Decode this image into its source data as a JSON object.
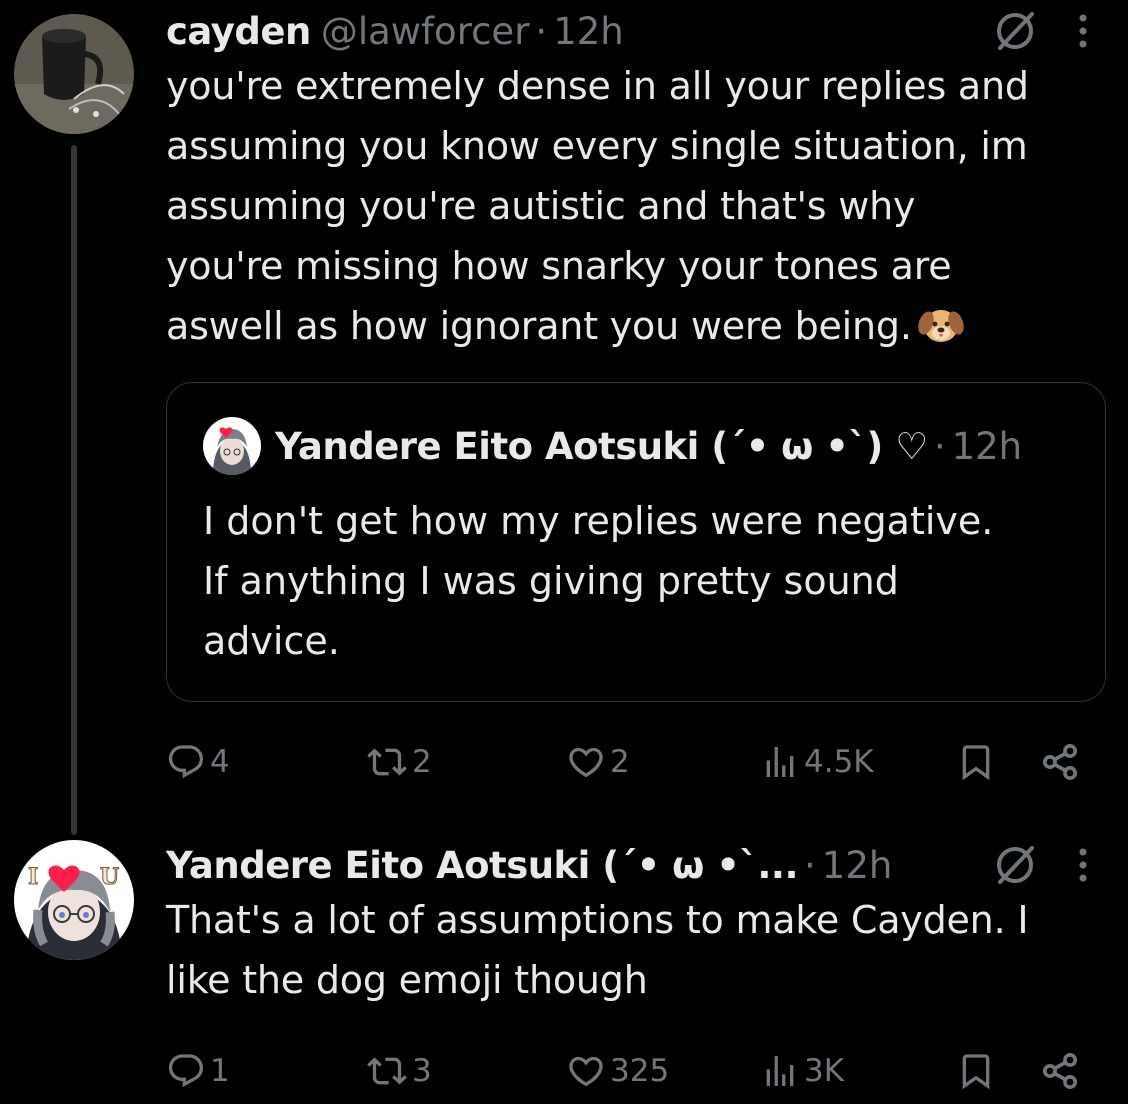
{
  "tweet1": {
    "name": "cayden",
    "handle": "@lawforcer",
    "separator": "·",
    "time": "12h",
    "text_lines": [
      "you're extremely dense in all your replies and",
      "assuming you know every single situation, im",
      "assuming you're autistic and that's why",
      "you're missing how snarky your tones are",
      "aswell as how ignorant you were being."
    ],
    "emoji": "dog-face",
    "quote": {
      "name": "Yandere Eito Aotsuki (´• ω •`) ♡",
      "separator": "·",
      "time": "12h",
      "text_lines": [
        "I don't get how my replies were negative.",
        "If anything I was giving pretty sound",
        "advice."
      ]
    },
    "actions": {
      "replies": "4",
      "reposts": "2",
      "likes": "2",
      "views": "4.5K"
    }
  },
  "tweet2": {
    "name": "Yandere Eito Aotsuki (´• ω •`...",
    "separator": "·",
    "time": "12h",
    "text_lines": [
      "That's a lot of assumptions to make Cayden. I",
      "like the dog emoji though"
    ],
    "actions": {
      "replies": "1",
      "reposts": "3",
      "likes": "325",
      "views": "3K"
    }
  },
  "colors": {
    "background": "#000000",
    "text": "#e7e9ea",
    "secondary": "#71767b",
    "border": "#2f3336"
  },
  "icons": [
    "grok-icon",
    "more-icon",
    "reply-icon",
    "repost-icon",
    "like-icon",
    "views-icon",
    "bookmark-icon",
    "share-icon"
  ]
}
